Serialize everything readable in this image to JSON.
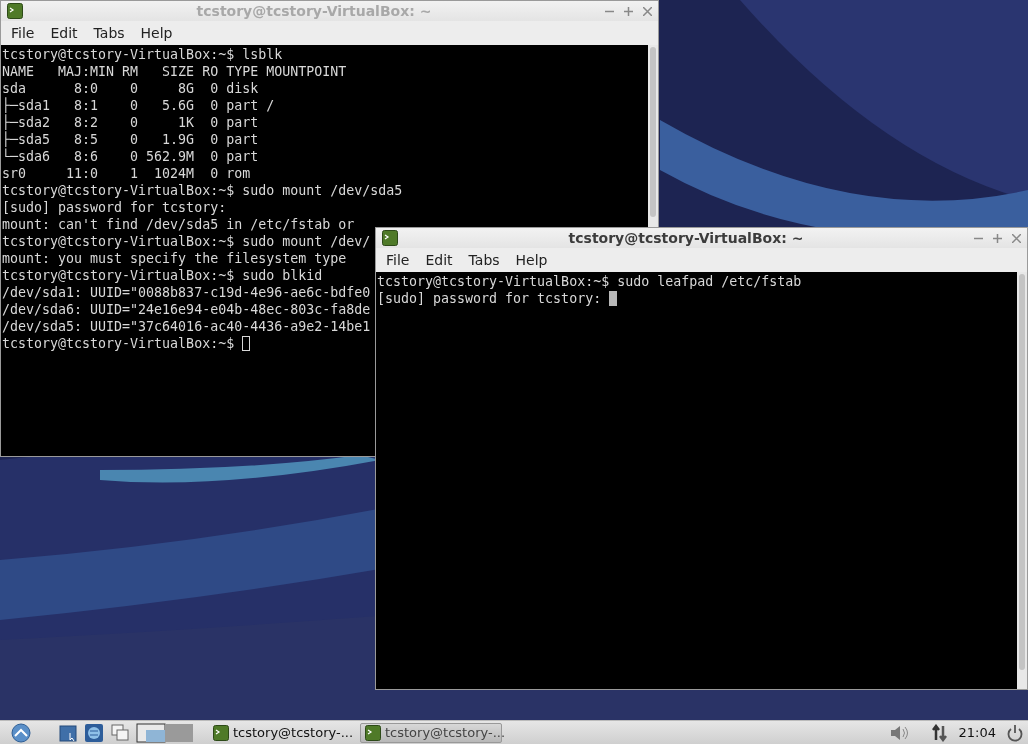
{
  "windows": [
    {
      "title": "tcstory@tcstory-VirtualBox: ~",
      "active": false,
      "menu": [
        "File",
        "Edit",
        "Tabs",
        "Help"
      ],
      "lines": [
        "tcstory@tcstory-VirtualBox:~$ lsblk",
        "NAME   MAJ:MIN RM   SIZE RO TYPE MOUNTPOINT",
        "sda      8:0    0     8G  0 disk",
        "├─sda1   8:1    0   5.6G  0 part /",
        "├─sda2   8:2    0     1K  0 part",
        "├─sda5   8:5    0   1.9G  0 part",
        "└─sda6   8:6    0 562.9M  0 part",
        "sr0     11:0    1  1024M  0 rom",
        "tcstory@tcstory-VirtualBox:~$ sudo mount /dev/sda5",
        "[sudo] password for tcstory:",
        "mount: can't find /dev/sda5 in /etc/fstab or",
        "tcstory@tcstory-VirtualBox:~$ sudo mount /dev/",
        "mount: you must specify the filesystem type",
        "tcstory@tcstory-VirtualBox:~$ sudo blkid",
        "/dev/sda1: UUID=\"0088b837-c19d-4e96-ae6c-bdfe0",
        "/dev/sda6: UUID=\"24e16e94-e04b-48ec-803c-fa8de",
        "/dev/sda5: UUID=\"37c64016-ac40-4436-a9e2-14be1",
        "tcstory@tcstory-VirtualBox:~$"
      ]
    },
    {
      "title": "tcstory@tcstory-VirtualBox: ~",
      "active": true,
      "menu": [
        "File",
        "Edit",
        "Tabs",
        "Help"
      ],
      "lines": [
        "tcstory@tcstory-VirtualBox:~$ sudo leafpad /etc/fstab",
        "[sudo] password for tcstory:"
      ]
    }
  ],
  "taskbar": {
    "tasks": [
      {
        "label": "tcstory@tcstory-...",
        "selected": false
      },
      {
        "label": "tcstory@tcstory-...",
        "selected": true
      }
    ],
    "clock": "21:04"
  }
}
